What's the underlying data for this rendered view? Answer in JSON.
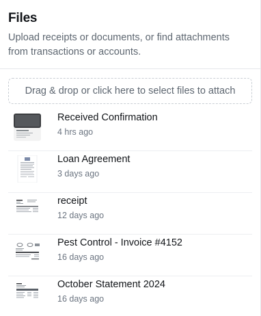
{
  "header": {
    "title": "Files",
    "subtitle": "Upload receipts or documents, or find attachments from transactions or accounts."
  },
  "dropzone": {
    "label": "Drag & drop or click here to select files to attach"
  },
  "files": [
    {
      "name": "Received Confirmation",
      "time": "4 hrs ago",
      "thumbnail": "photo-receipt-thumbnail"
    },
    {
      "name": "Loan Agreement",
      "time": "3 days ago",
      "thumbnail": "document-thumbnail"
    },
    {
      "name": "receipt",
      "time": "12 days ago",
      "thumbnail": "receipt-thumbnail"
    },
    {
      "name": "Pest Control - Invoice #4152",
      "time": "16 days ago",
      "thumbnail": "invoice-thumbnail"
    },
    {
      "name": "October Statement 2024",
      "time": "16 days ago",
      "thumbnail": "statement-thumbnail"
    }
  ]
}
